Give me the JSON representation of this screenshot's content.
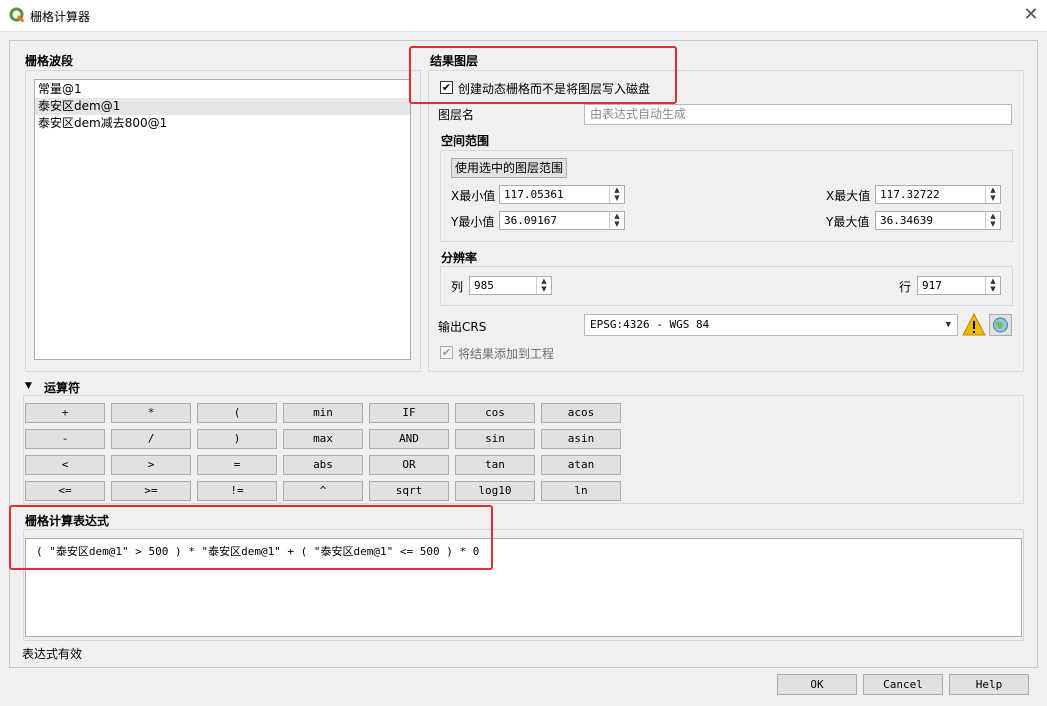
{
  "window": {
    "title": "栅格计算器"
  },
  "bands": {
    "header": "栅格波段",
    "items": [
      "常量@1",
      "泰安区dem@1",
      "泰安区dem减去800@1"
    ]
  },
  "result_layer": {
    "header": "结果图层",
    "virtual_checkbox": {
      "label": "创建动态栅格而不是将图层写入磁盘",
      "checked": true
    },
    "layer_name_label": "图层名",
    "layer_name_placeholder": "由表达式自动生成",
    "extent": {
      "header": "空间范围",
      "use_selected_button": "使用选中的图层范围",
      "xmin_label": "X最小值",
      "xmin": "117.05361",
      "xmax_label": "X最大值",
      "xmax": "117.32722",
      "ymin_label": "Y最小值",
      "ymin": "36.09167",
      "ymax_label": "Y最大值",
      "ymax": "36.34639"
    },
    "resolution": {
      "header": "分辨率",
      "cols_label": "列",
      "cols": "985",
      "rows_label": "行",
      "rows": "917"
    },
    "crs_label": "输出CRS",
    "crs_value": "EPSG:4326 - WGS 84",
    "add_to_project": {
      "label": "将结果添加到工程",
      "checked": true,
      "enabled": false
    }
  },
  "operators": {
    "header": "运算符",
    "rows": [
      [
        "+",
        "*",
        "(",
        "min",
        "IF",
        "cos",
        "acos"
      ],
      [
        "-",
        "/",
        ")",
        "max",
        "AND",
        "sin",
        "asin"
      ],
      [
        "<",
        ">",
        "=",
        "abs",
        "OR",
        "tan",
        "atan"
      ],
      [
        "<=",
        ">=",
        "!=",
        "^",
        "sqrt",
        "log10",
        "ln"
      ]
    ]
  },
  "expression": {
    "header": "栅格计算表达式",
    "text": "( \"泰安区dem@1\" > 500 ) * \"泰安区dem@1\" + ( \"泰安区dem@1\" <= 500 ) * 0",
    "status": "表达式有效"
  },
  "buttons": {
    "ok": "OK",
    "cancel": "Cancel",
    "help": "Help"
  },
  "colors": {
    "highlight": "#e0302e",
    "qgis_green": "#589632",
    "warning": "#f5b800"
  }
}
